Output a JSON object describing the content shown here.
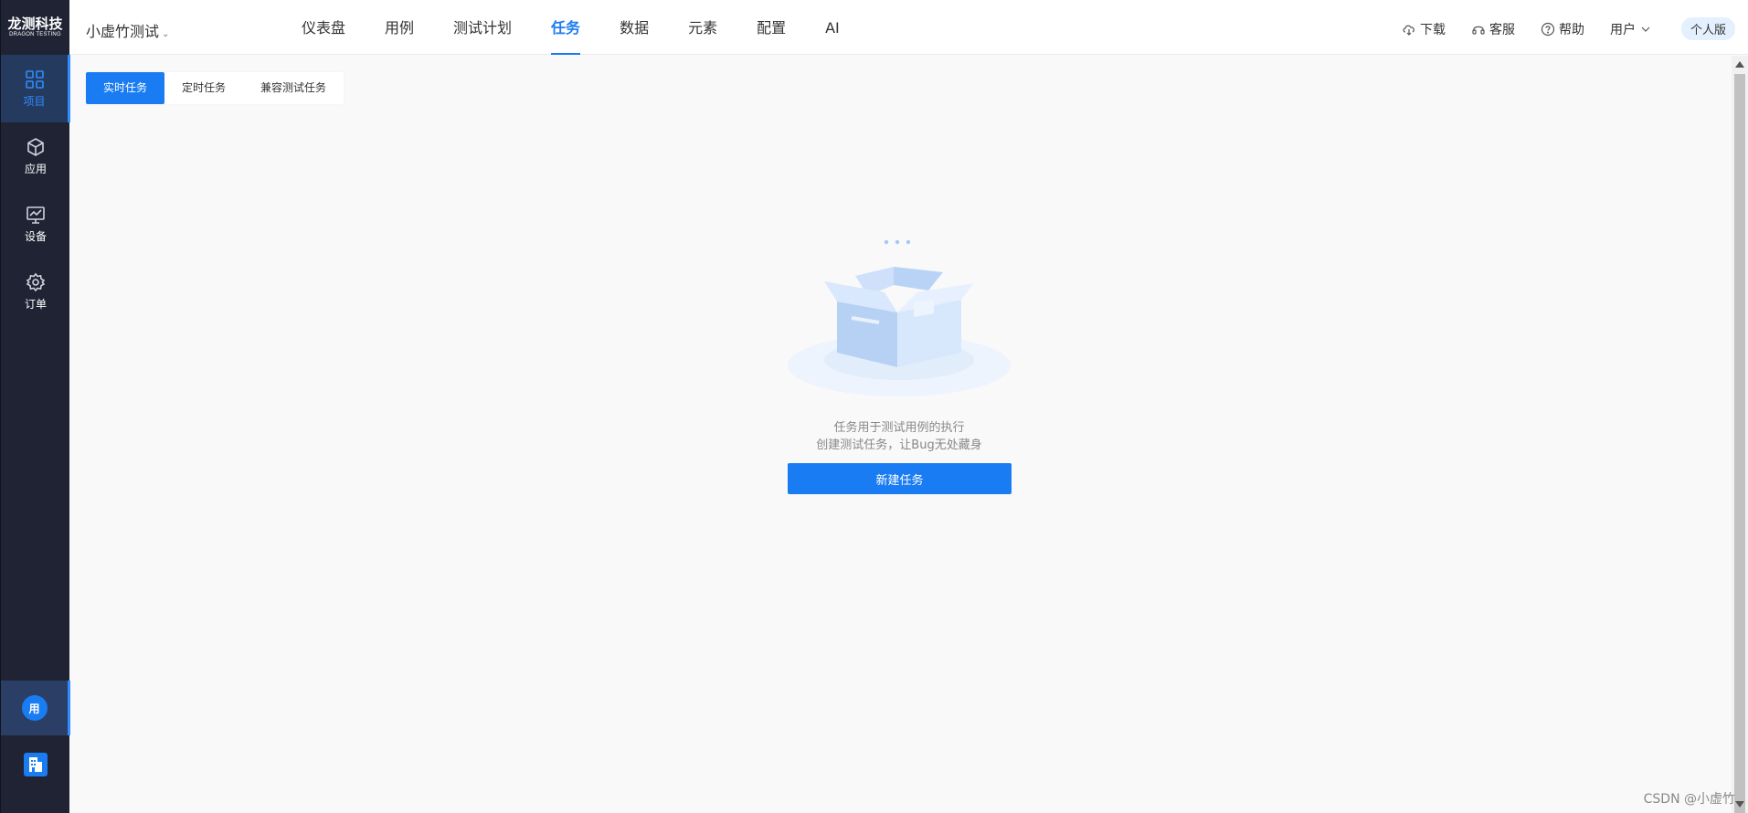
{
  "brand": {
    "name": "龙测科技",
    "subtitle": "DRAGON TESTING"
  },
  "sidebar": {
    "items": [
      {
        "label": "项目",
        "icon": "grid-icon",
        "active": true
      },
      {
        "label": "应用",
        "icon": "cube-icon",
        "active": false
      },
      {
        "label": "设备",
        "icon": "monitor-icon",
        "active": false
      },
      {
        "label": "订单",
        "icon": "gear-icon",
        "active": false
      }
    ],
    "user_avatar": "用",
    "org_icon": "building-icon"
  },
  "header": {
    "project_name": "小虚竹测试",
    "nav": [
      "仪表盘",
      "用例",
      "测试计划",
      "任务",
      "数据",
      "元素",
      "配置",
      "AI"
    ],
    "active_nav": "任务",
    "links": {
      "download": "下载",
      "support": "客服",
      "help": "帮助",
      "user": "用户"
    },
    "edition": "个人版"
  },
  "tabs": [
    "实时任务",
    "定时任务",
    "兼容测试任务"
  ],
  "active_tab": "实时任务",
  "empty_state": {
    "line1": "任务用于测试用例的执行",
    "line2": "创建测试任务，让Bug无处藏身",
    "button": "新建任务"
  },
  "watermark": "CSDN @小虚竹",
  "colors": {
    "accent": "#1a7cf2",
    "sidebar_bg": "#1f2333"
  }
}
